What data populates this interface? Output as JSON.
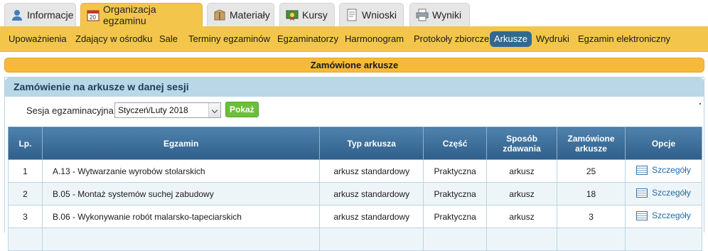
{
  "tabs": [
    {
      "label": "Informacje",
      "icon": "user-icon"
    },
    {
      "label": "Organizacja egzaminu",
      "icon": "calendar-icon"
    },
    {
      "label": "Materiały",
      "icon": "package-icon"
    },
    {
      "label": "Kursy",
      "icon": "certificate-icon"
    },
    {
      "label": "Wnioski",
      "icon": "document-icon"
    },
    {
      "label": "Wyniki",
      "icon": "printer-icon"
    }
  ],
  "active_tab": "Organizacja egzaminu",
  "subnav": [
    "Upoważnienia",
    "Zdający w ośrodku",
    "Sale",
    "Terminy egzaminów",
    "Egzaminatorzy",
    "Harmonogram",
    "Protokoły zbiorcze",
    "Arkusze",
    "Wydruki",
    "Egzamin elektroniczny"
  ],
  "active_subnav": "Arkusze",
  "heading": "Zamówione arkusze",
  "panel_title": "Zamówienie na arkusze w danej sesji",
  "session": {
    "label": "Sesja egzaminacyjna",
    "selected": "Styczeń/Luty 2018",
    "button": "Pokaż"
  },
  "table": {
    "headers": [
      "Lp.",
      "Egzamin",
      "Typ arkusza",
      "Część",
      "Sposób zdawania",
      "Zamówione arkusze",
      "Opcje"
    ],
    "rows": [
      {
        "lp": "1",
        "egzamin": "A.13 - Wytwarzanie wyrobów stolarskich",
        "typ": "arkusz standardowy",
        "czesc": "Praktyczna",
        "sposob": "arkusz",
        "zamowione": "25",
        "opcje": "Szczegóły"
      },
      {
        "lp": "2",
        "egzamin": "B.05 - Montaż systemów suchej zabudowy",
        "typ": "arkusz standardowy",
        "czesc": "Praktyczna",
        "sposob": "arkusz",
        "zamowione": "18",
        "opcje": "Szczegóły"
      },
      {
        "lp": "3",
        "egzamin": "B.06 - Wykonywanie robót malarsko-tapeciarskich",
        "typ": "arkusz standardowy",
        "czesc": "Praktyczna",
        "sposob": "arkusz",
        "zamowione": "3",
        "opcje": "Szczegóły"
      }
    ]
  },
  "colors": {
    "accent": "#f3c64b",
    "heading_bar": "#f6b93a",
    "table_header": "#3b6d98",
    "active_subnav": "#2f6a8e",
    "button_green": "#6cbf3c"
  }
}
